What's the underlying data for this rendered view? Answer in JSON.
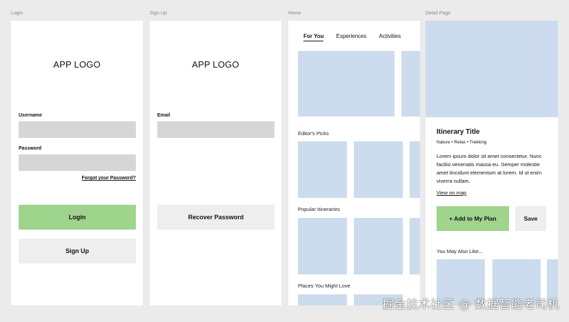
{
  "frames": {
    "login": {
      "label": "Login",
      "logo": "APP LOGO",
      "username_label": "Username",
      "password_label": "Password",
      "forgot_link": "Forgot your Password?",
      "login_button": "Login",
      "signup_button": "Sign Up"
    },
    "signup": {
      "label": "Sign Up",
      "logo": "APP LOGO",
      "email_label": "Email",
      "recover_button": "Recover Password"
    },
    "home": {
      "label": "Home",
      "tabs": [
        "For You",
        "Experiences",
        "Activities"
      ],
      "sections": [
        "Editor's Picks",
        "Popular Itineraries",
        "Places You Might Love"
      ]
    },
    "detail": {
      "label": "Detail Page",
      "title": "Itinerary Title",
      "tags": "Nature • Relax • Trekking",
      "body": "Lorem ipsum dolor sit amet consectetur. Nunc facilisi venenatis massa eu. Semper molestie amet tincidunt elementum at lorem. Id ut enim viverra nullam.",
      "map_link": "View on map",
      "add_button": "+ Add to My Plan",
      "save_button": "Save",
      "also_like": "You May Also Like..."
    }
  },
  "watermark": "掘金技术社区 @ 数据智能老司机",
  "colors": {
    "background": "#ebebeb",
    "frame": "#ffffff",
    "placeholder_image": "#ccdcee",
    "input": "#d6d6d6",
    "primary_button": "#9fd48d",
    "secondary_button": "#eeeeee"
  }
}
